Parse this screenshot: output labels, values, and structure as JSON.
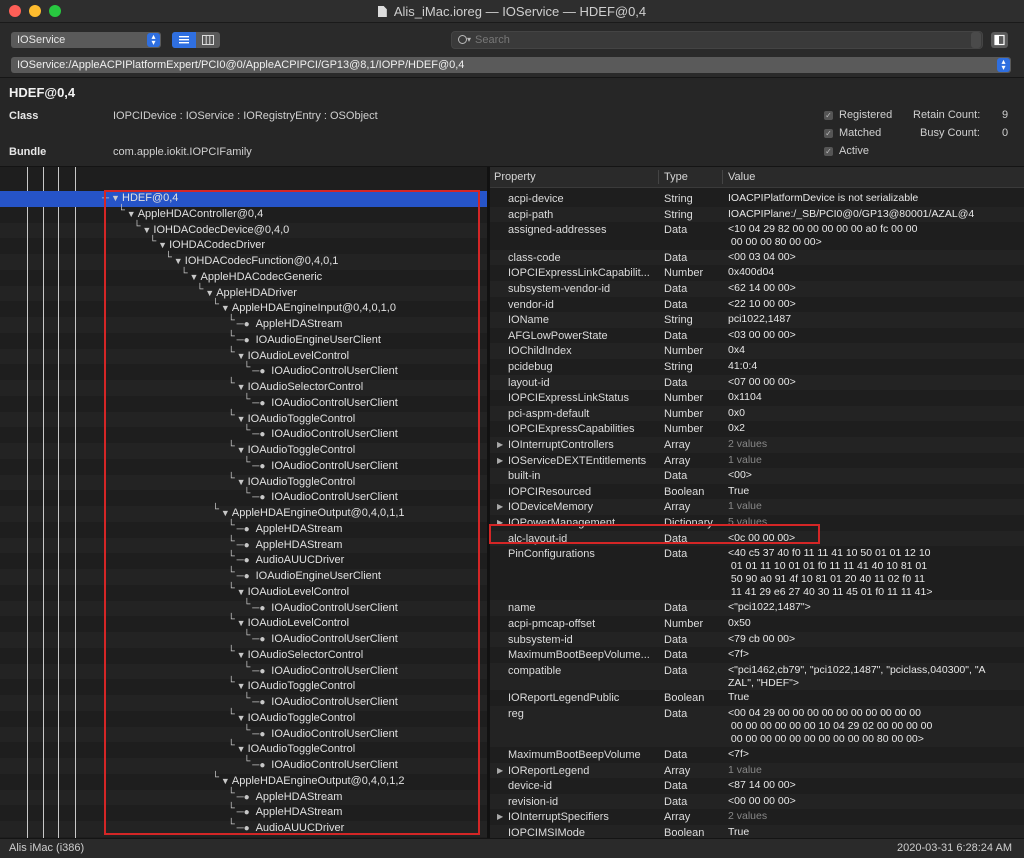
{
  "window": {
    "title": "Alis_iMac.ioreg — IOService — HDEF@0,4",
    "traffic_light_colors": [
      "#fe5f57",
      "#febc2e",
      "#28c840"
    ]
  },
  "toolbar": {
    "plane": "IOService",
    "search_placeholder": "Search",
    "path": "IOService:/AppleACPIPlatformExpert/PCI0@0/AppleACPIPCI/GP13@8,1/IOPP/HDEF@0,4"
  },
  "info": {
    "title": "HDEF@0,4",
    "class_label": "Class",
    "class_value": "IOPCIDevice : IOService : IORegistryEntry : OSObject",
    "bundle_label": "Bundle",
    "bundle_value": "com.apple.iokit.IOPCIFamily",
    "flags": [
      "Registered",
      "Matched",
      "Active"
    ],
    "retain_label": "Retain Count:",
    "retain_value": "9",
    "busy_label": "Busy Count:",
    "busy_value": "0"
  },
  "tree": [
    {
      "label": "HDEF@0,4",
      "depth": 0,
      "icon": "disclosure-open",
      "selected": true
    },
    {
      "label": "AppleHDAController@0,4",
      "depth": 1,
      "icon": "disclosure-open"
    },
    {
      "label": "IOHDACodecDevice@0,4,0",
      "depth": 2,
      "icon": "disclosure-open"
    },
    {
      "label": "IOHDACodecDriver",
      "depth": 3,
      "icon": "disclosure-open"
    },
    {
      "label": "IOHDACodecFunction@0,4,0,1",
      "depth": 4,
      "icon": "disclosure-open"
    },
    {
      "label": "AppleHDACodecGeneric",
      "depth": 5,
      "icon": "disclosure-open"
    },
    {
      "label": "AppleHDADriver",
      "depth": 6,
      "icon": "disclosure-open"
    },
    {
      "label": "AppleHDAEngineInput@0,4,0,1,0",
      "depth": 7,
      "icon": "disclosure-open"
    },
    {
      "label": "AppleHDAStream",
      "depth": 8,
      "icon": "leaf"
    },
    {
      "label": "IOAudioEngineUserClient",
      "depth": 8,
      "icon": "leaf"
    },
    {
      "label": "IOAudioLevelControl",
      "depth": 8,
      "icon": "disclosure-open"
    },
    {
      "label": "IOAudioControlUserClient",
      "depth": 9,
      "icon": "leaf"
    },
    {
      "label": "IOAudioSelectorControl",
      "depth": 8,
      "icon": "disclosure-open"
    },
    {
      "label": "IOAudioControlUserClient",
      "depth": 9,
      "icon": "leaf"
    },
    {
      "label": "IOAudioToggleControl",
      "depth": 8,
      "icon": "disclosure-open"
    },
    {
      "label": "IOAudioControlUserClient",
      "depth": 9,
      "icon": "leaf"
    },
    {
      "label": "IOAudioToggleControl",
      "depth": 8,
      "icon": "disclosure-open"
    },
    {
      "label": "IOAudioControlUserClient",
      "depth": 9,
      "icon": "leaf"
    },
    {
      "label": "IOAudioToggleControl",
      "depth": 8,
      "icon": "disclosure-open"
    },
    {
      "label": "IOAudioControlUserClient",
      "depth": 9,
      "icon": "leaf"
    },
    {
      "label": "AppleHDAEngineOutput@0,4,0,1,1",
      "depth": 7,
      "icon": "disclosure-open"
    },
    {
      "label": "AppleHDAStream",
      "depth": 8,
      "icon": "leaf"
    },
    {
      "label": "AppleHDAStream",
      "depth": 8,
      "icon": "leaf"
    },
    {
      "label": "AudioAUUCDriver",
      "depth": 8,
      "icon": "leaf"
    },
    {
      "label": "IOAudioEngineUserClient",
      "depth": 8,
      "icon": "leaf"
    },
    {
      "label": "IOAudioLevelControl",
      "depth": 8,
      "icon": "disclosure-open"
    },
    {
      "label": "IOAudioControlUserClient",
      "depth": 9,
      "icon": "leaf"
    },
    {
      "label": "IOAudioLevelControl",
      "depth": 8,
      "icon": "disclosure-open"
    },
    {
      "label": "IOAudioControlUserClient",
      "depth": 9,
      "icon": "leaf"
    },
    {
      "label": "IOAudioSelectorControl",
      "depth": 8,
      "icon": "disclosure-open"
    },
    {
      "label": "IOAudioControlUserClient",
      "depth": 9,
      "icon": "leaf"
    },
    {
      "label": "IOAudioToggleControl",
      "depth": 8,
      "icon": "disclosure-open"
    },
    {
      "label": "IOAudioControlUserClient",
      "depth": 9,
      "icon": "leaf"
    },
    {
      "label": "IOAudioToggleControl",
      "depth": 8,
      "icon": "disclosure-open"
    },
    {
      "label": "IOAudioControlUserClient",
      "depth": 9,
      "icon": "leaf"
    },
    {
      "label": "IOAudioToggleControl",
      "depth": 8,
      "icon": "disclosure-open"
    },
    {
      "label": "IOAudioControlUserClient",
      "depth": 9,
      "icon": "leaf"
    },
    {
      "label": "AppleHDAEngineOutput@0,4,0,1,2",
      "depth": 7,
      "icon": "disclosure-open"
    },
    {
      "label": "AppleHDAStream",
      "depth": 8,
      "icon": "leaf"
    },
    {
      "label": "AppleHDAStream",
      "depth": 8,
      "icon": "leaf"
    },
    {
      "label": "AudioAUUCDriver",
      "depth": 8,
      "icon": "leaf"
    }
  ],
  "properties": {
    "headers": [
      "Property",
      "Type",
      "Value"
    ],
    "rows": [
      {
        "name": "acpi-device",
        "type": "String",
        "value": "IOACPIPlatformDevice is not serializable"
      },
      {
        "name": "acpi-path",
        "type": "String",
        "value": "IOACPIPlane:/_SB/PCI0@0/GP13@80001/AZAL@4"
      },
      {
        "name": "assigned-addresses",
        "type": "Data",
        "value": "<10 04 29 82 00 00 00 00 00 a0 fc 00 00\n 00 00 00 80 00 00>"
      },
      {
        "name": "class-code",
        "type": "Data",
        "value": "<00 03 04 00>"
      },
      {
        "name": "IOPCIExpressLinkCapabilit...",
        "type": "Number",
        "value": "0x400d04"
      },
      {
        "name": "subsystem-vendor-id",
        "type": "Data",
        "value": "<62 14 00 00>"
      },
      {
        "name": "vendor-id",
        "type": "Data",
        "value": "<22 10 00 00>"
      },
      {
        "name": "IOName",
        "type": "String",
        "value": "pci1022,1487"
      },
      {
        "name": "AFGLowPowerState",
        "type": "Data",
        "value": "<03 00 00 00>"
      },
      {
        "name": "IOChildIndex",
        "type": "Number",
        "value": "0x4"
      },
      {
        "name": "pcidebug",
        "type": "String",
        "value": "41:0:4"
      },
      {
        "name": "layout-id",
        "type": "Data",
        "value": "<07 00 00 00>"
      },
      {
        "name": "IOPCIExpressLinkStatus",
        "type": "Number",
        "value": "0x1104"
      },
      {
        "name": "pci-aspm-default",
        "type": "Number",
        "value": "0x0"
      },
      {
        "name": "IOPCIExpressCapabilities",
        "type": "Number",
        "value": "0x2"
      },
      {
        "name": "IOInterruptControllers",
        "type": "Array",
        "value": "2 values",
        "expandable": true
      },
      {
        "name": "IOServiceDEXTEntitlements",
        "type": "Array",
        "value": "1 value",
        "expandable": true
      },
      {
        "name": "built-in",
        "type": "Data",
        "value": "<00>"
      },
      {
        "name": "IOPCIResourced",
        "type": "Boolean",
        "value": "True"
      },
      {
        "name": "IODeviceMemory",
        "type": "Array",
        "value": "1 value",
        "expandable": true
      },
      {
        "name": "IOPowerManagement",
        "type": "Dictionary",
        "value": "5 values",
        "expandable": true
      },
      {
        "name": "alc-layout-id",
        "type": "Data",
        "value": "<0c 00 00 00>"
      },
      {
        "name": "PinConfigurations",
        "type": "Data",
        "value": "<40 c5 37 40 f0 11 11 41 10 50 01 01 12 10\n 01 01 11 10 01 01 f0 11 11 41 40 10 81 01\n 50 90 a0 91 4f 10 81 01 20 40 11 02 f0 11\n 11 41 29 e6 27 40 30 11 45 01 f0 11 11 41>"
      },
      {
        "name": "name",
        "type": "Data",
        "value": "<\"pci1022,1487\">"
      },
      {
        "name": "acpi-pmcap-offset",
        "type": "Number",
        "value": "0x50"
      },
      {
        "name": "subsystem-id",
        "type": "Data",
        "value": "<79 cb 00 00>"
      },
      {
        "name": "MaximumBootBeepVolume...",
        "type": "Data",
        "value": "<7f>"
      },
      {
        "name": "compatible",
        "type": "Data",
        "value": "<\"pci1462,cb79\", \"pci1022,1487\", \"pciclass,040300\", \"A\nZAL\", \"HDEF\">"
      },
      {
        "name": "IOReportLegendPublic",
        "type": "Boolean",
        "value": "True"
      },
      {
        "name": "reg",
        "type": "Data",
        "value": "<00 04 29 00 00 00 00 00 00 00 00 00 00\n 00 00 00 00 00 00 10 04 29 02 00 00 00 00\n 00 00 00 00 00 00 00 00 00 00 80 00 00>"
      },
      {
        "name": "MaximumBootBeepVolume",
        "type": "Data",
        "value": "<7f>"
      },
      {
        "name": "IOReportLegend",
        "type": "Array",
        "value": "1 value",
        "expandable": true
      },
      {
        "name": "device-id",
        "type": "Data",
        "value": "<87 14 00 00>"
      },
      {
        "name": "revision-id",
        "type": "Data",
        "value": "<00 00 00 00>"
      },
      {
        "name": "IOInterruptSpecifiers",
        "type": "Array",
        "value": "2 values",
        "expandable": true
      },
      {
        "name": "IOPCIMSIMode",
        "type": "Boolean",
        "value": "True"
      }
    ]
  },
  "status": {
    "left": "Alis iMac (i386)",
    "right": "2020-03-31 6:28:24 AM"
  },
  "colors": {
    "selection": "#2654c8",
    "highlight_box": "#d42626",
    "accent": "#2f6fe0"
  }
}
